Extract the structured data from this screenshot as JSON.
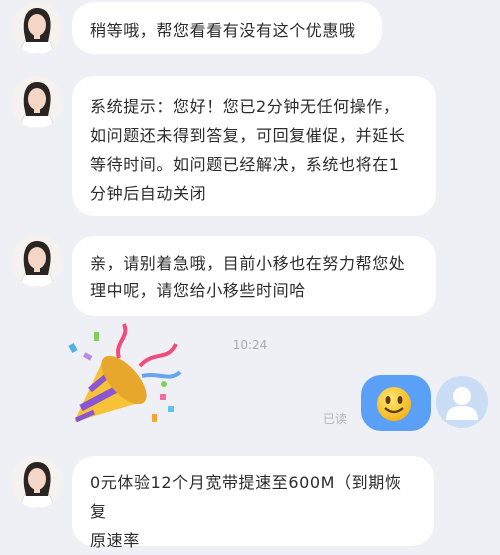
{
  "messages": [
    {
      "from": "agent",
      "text": "稍等哦，帮您看看有没有这个优惠哦"
    },
    {
      "from": "agent",
      "lines": [
        "系统提示：您好！您已2分钟无任何操作，",
        "如问题还未得到答复，可回复催促，并延长",
        "等待时间。如问题已经解决，系统也将在1",
        "分钟后自动关闭"
      ]
    },
    {
      "from": "agent",
      "lines": [
        "亲，请别着急哦，目前小移也在努力帮您处",
        "理中呢，请您给小移些时间哈"
      ]
    },
    {
      "from": "agent",
      "lines": [
        "0元体验12个月宽带提速至600M（到期恢复",
        "原速率"
      ]
    }
  ],
  "timestamp": "10:24",
  "read_status": "已读",
  "user_message": {
    "emoji": "smiley-face-icon"
  },
  "colors": {
    "user_bubble": "#5aa0f6",
    "background": "#eef0f5"
  }
}
